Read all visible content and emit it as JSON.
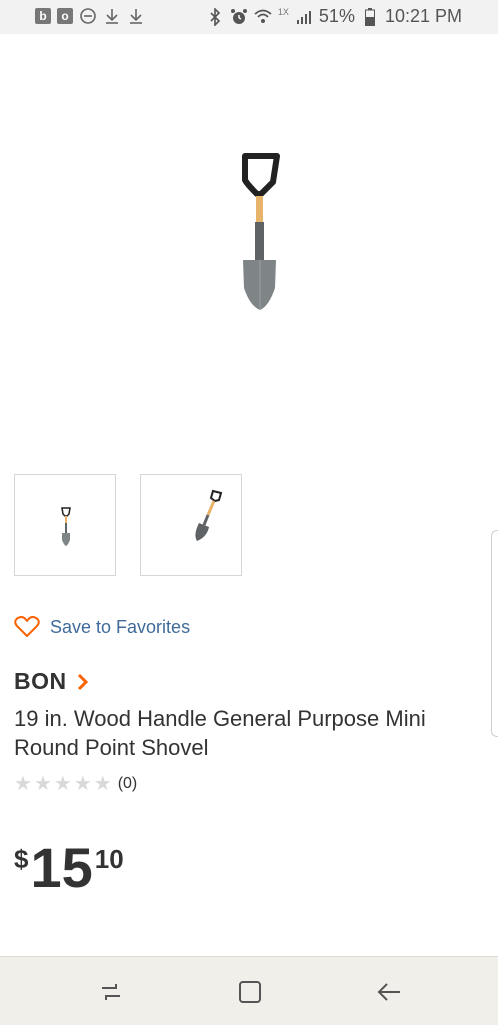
{
  "status_bar": {
    "left_icons": [
      "b-icon",
      "outlook-icon",
      "dnd-icon",
      "download-icon",
      "download-icon"
    ],
    "b_label": "b",
    "outlook_label": "o",
    "signal_label": "1X",
    "battery_percent": "51%",
    "time": "10:21 PM"
  },
  "favorites": {
    "label": "Save to Favorites"
  },
  "product": {
    "brand": "BON",
    "title": "19 in. Wood Handle General Purpose Mini Round Point Shovel",
    "rating_count": "(0)",
    "rating_value": 0,
    "rating_max": 5,
    "price": {
      "currency": "$",
      "dollars": "15",
      "cents": "10"
    }
  },
  "colors": {
    "accent": "#f96302",
    "link": "#3f6b9a",
    "star_empty": "#d9d9d9"
  }
}
